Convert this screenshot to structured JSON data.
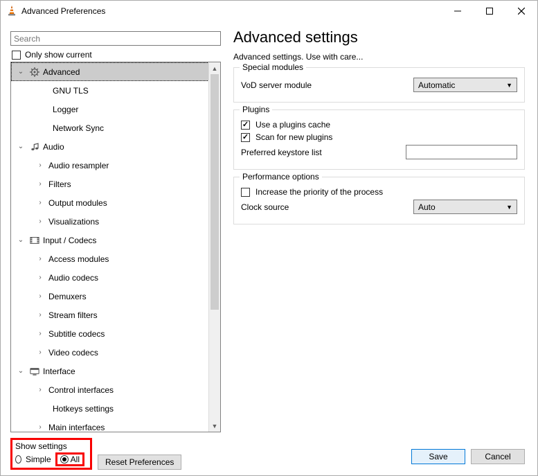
{
  "window": {
    "title": "Advanced Preferences"
  },
  "search": {
    "placeholder": "Search"
  },
  "only_show_current": {
    "label": "Only show current",
    "checked": false
  },
  "tree": [
    {
      "label": "Advanced",
      "level": 0,
      "icon": "gear",
      "expander": "open",
      "selected": true
    },
    {
      "label": "GNU TLS",
      "level": 1,
      "icon": "",
      "expander": "none"
    },
    {
      "label": "Logger",
      "level": 1,
      "icon": "",
      "expander": "none"
    },
    {
      "label": "Network Sync",
      "level": 1,
      "icon": "",
      "expander": "none"
    },
    {
      "label": "Audio",
      "level": 0,
      "icon": "note",
      "expander": "open"
    },
    {
      "label": "Audio resampler",
      "level": 2,
      "icon": "",
      "expander": "closed"
    },
    {
      "label": "Filters",
      "level": 2,
      "icon": "",
      "expander": "closed"
    },
    {
      "label": "Output modules",
      "level": 2,
      "icon": "",
      "expander": "closed"
    },
    {
      "label": "Visualizations",
      "level": 2,
      "icon": "",
      "expander": "closed"
    },
    {
      "label": "Input / Codecs",
      "level": 0,
      "icon": "codec",
      "expander": "open"
    },
    {
      "label": "Access modules",
      "level": 2,
      "icon": "",
      "expander": "closed"
    },
    {
      "label": "Audio codecs",
      "level": 2,
      "icon": "",
      "expander": "closed"
    },
    {
      "label": "Demuxers",
      "level": 2,
      "icon": "",
      "expander": "closed"
    },
    {
      "label": "Stream filters",
      "level": 2,
      "icon": "",
      "expander": "closed"
    },
    {
      "label": "Subtitle codecs",
      "level": 2,
      "icon": "",
      "expander": "closed"
    },
    {
      "label": "Video codecs",
      "level": 2,
      "icon": "",
      "expander": "closed"
    },
    {
      "label": "Interface",
      "level": 0,
      "icon": "iface",
      "expander": "open"
    },
    {
      "label": "Control interfaces",
      "level": 2,
      "icon": "",
      "expander": "closed"
    },
    {
      "label": "Hotkeys settings",
      "level": 1,
      "icon": "",
      "expander": "none"
    },
    {
      "label": "Main interfaces",
      "level": 2,
      "icon": "",
      "expander": "closed"
    }
  ],
  "show_settings": {
    "legend": "Show settings",
    "simple": "Simple",
    "all": "All",
    "selected": "all"
  },
  "reset_btn": "Reset Preferences",
  "right": {
    "heading": "Advanced settings",
    "subtitle": "Advanced settings. Use with care...",
    "groups": {
      "special": {
        "legend": "Special modules",
        "vod_label": "VoD server module",
        "vod_value": "Automatic"
      },
      "plugins": {
        "legend": "Plugins",
        "use_cache": {
          "label": "Use a plugins cache",
          "checked": true
        },
        "scan_new": {
          "label": "Scan for new plugins",
          "checked": true
        },
        "keystore_label": "Preferred keystore list",
        "keystore_value": ""
      },
      "perf": {
        "legend": "Performance options",
        "increase_prio": {
          "label": "Increase the priority of the process",
          "checked": false
        },
        "clock_label": "Clock source",
        "clock_value": "Auto"
      }
    }
  },
  "footer": {
    "save": "Save",
    "cancel": "Cancel"
  }
}
